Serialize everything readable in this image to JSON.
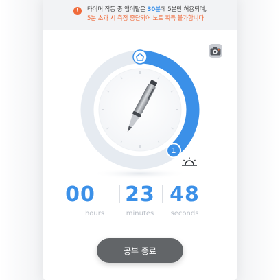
{
  "notice": {
    "icon": "exclamation-icon",
    "line1_prefix": "타이머 작동 중 앱이탈은 ",
    "line1_highlight": "30분",
    "line1_suffix": "에 5분만 허용되며,",
    "line2": "5분 초과 시 측정 중단되어 노트 획득 불가합니다."
  },
  "timer": {
    "progress_fraction": 0.39,
    "center_icon": "pen-icon",
    "start_marker_icon": "home-icon",
    "end_marker_label": "1"
  },
  "time": {
    "hours": "00",
    "minutes": "23",
    "seconds": "48",
    "hours_label": "hours",
    "minutes_label": "minutes",
    "seconds_label": "seconds"
  },
  "end_button_label": "공부 종료",
  "colors": {
    "accent": "#3b90e8",
    "ring_track": "#e6ebf1",
    "warning": "#f06a3a",
    "button": "#626568"
  }
}
